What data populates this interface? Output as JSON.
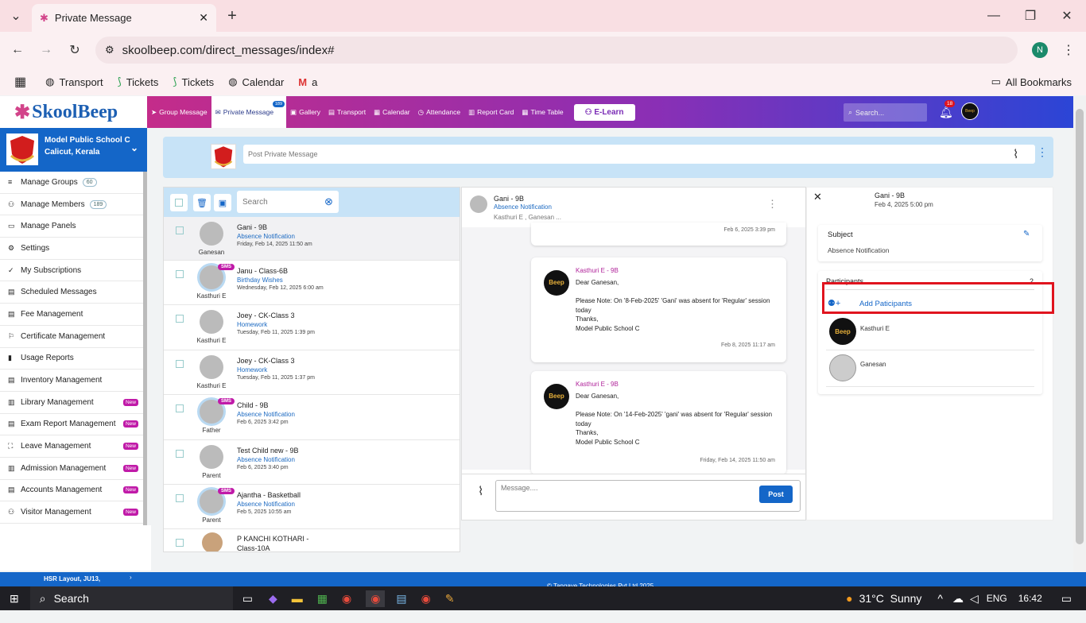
{
  "browser": {
    "tab_title": "Private Message",
    "url": "skoolbeep.com/direct_messages/index#",
    "profile_initial": "N",
    "bookmarks": [
      "Transport",
      "Tickets",
      "Tickets",
      "Calendar",
      "a"
    ],
    "all_bookmarks": "All Bookmarks"
  },
  "app": {
    "logo": "SkoolBeep",
    "nav": [
      "Group Message",
      "Private Message",
      "Gallery",
      "Transport",
      "Calendar",
      "Attendance",
      "Report Card",
      "Time Table"
    ],
    "private_badge": "189",
    "elearn": "E-Learn",
    "search_placeholder": "Search...",
    "notif_count": "18"
  },
  "school": {
    "name": "Model Public School C",
    "place": "Calicut, Kerala"
  },
  "sidebar": {
    "items": [
      {
        "label": "Manage Groups",
        "count": "60",
        "new": ""
      },
      {
        "label": "Manage Members",
        "count": "189",
        "new": ""
      },
      {
        "label": "Manage Panels",
        "count": "",
        "new": ""
      },
      {
        "label": "Settings",
        "count": "",
        "new": ""
      },
      {
        "label": "My Subscriptions",
        "count": "",
        "new": ""
      },
      {
        "label": "Scheduled Messages",
        "count": "",
        "new": ""
      },
      {
        "label": "Fee Management",
        "count": "",
        "new": ""
      },
      {
        "label": "Certificate Management",
        "count": "",
        "new": ""
      },
      {
        "label": "Usage Reports",
        "count": "",
        "new": ""
      },
      {
        "label": "Inventory Management",
        "count": "",
        "new": ""
      },
      {
        "label": "Library Management",
        "count": "",
        "new": "New"
      },
      {
        "label": "Exam Report Management",
        "count": "",
        "new": "New"
      },
      {
        "label": "Leave Management",
        "count": "",
        "new": "New"
      },
      {
        "label": "Admission Management",
        "count": "",
        "new": "New"
      },
      {
        "label": "Accounts Management",
        "count": "",
        "new": "New"
      },
      {
        "label": "Visitor Management",
        "count": "",
        "new": "New"
      }
    ]
  },
  "post": {
    "placeholder": "Post Private Message"
  },
  "list": {
    "search_placeholder": "Search",
    "rows": [
      {
        "title": "Gani - 9B",
        "sub": "Absence Notification",
        "date": "Friday, Feb 14, 2025 11:50 am",
        "avatar": "Ganesan",
        "sms": ""
      },
      {
        "title": "Janu - Class-6B",
        "sub": "Birthday Wishes",
        "date": "Wednesday, Feb 12, 2025 6:00 am",
        "avatar": "Kasthuri E",
        "sms": "SMS"
      },
      {
        "title": "Joey - CK-Class 3",
        "sub": "Homework",
        "date": "Tuesday, Feb 11, 2025 1:39 pm",
        "avatar": "Kasthuri E",
        "sms": ""
      },
      {
        "title": "Joey - CK-Class 3",
        "sub": "Homework",
        "date": "Tuesday, Feb 11, 2025 1:37 pm",
        "avatar": "Kasthuri E",
        "sms": ""
      },
      {
        "title": "Child - 9B",
        "sub": "Absence Notification",
        "date": "Feb 6, 2025 3:42 pm",
        "avatar": "Father",
        "sms": "SMS"
      },
      {
        "title": "Test Child new - 9B",
        "sub": "Absence Notification",
        "date": "Feb 6, 2025 3:40 pm",
        "avatar": "Parent",
        "sms": ""
      },
      {
        "title": "Ajantha - Basketball",
        "sub": "Absence Notification",
        "date": "Feb 5, 2025 10:55 am",
        "avatar": "Parent",
        "sms": "SMS"
      },
      {
        "title": "P KANCHI KOTHARI - Class-10A",
        "sub": "",
        "date": "",
        "avatar": "",
        "sms": ""
      }
    ]
  },
  "chat": {
    "title": "Gani - 9B",
    "subject": "Absence Notification",
    "members": "Kasthuri E , Ganesan ...",
    "prev_time": "Feb 6, 2025 3:39 pm",
    "messages": [
      {
        "sender": "Kasthuri E - 9B",
        "greeting": "Dear Ganesan,",
        "body": "Please Note: On '8-Feb-2025' 'Gani' was absent for 'Regular' session today",
        "thanks": "Thanks,",
        "sign": "Model Public School C",
        "time": "Feb 8, 2025 11:17 am"
      },
      {
        "sender": "Kasthuri E - 9B",
        "greeting": "Dear Ganesan,",
        "body": "Please Note: On '14-Feb-2025' 'gani' was absent for 'Regular' session today",
        "thanks": "Thanks,",
        "sign": "Model Public School C",
        "time": "Friday, Feb 14, 2025 11:50 am"
      }
    ],
    "input_placeholder": "Message....",
    "post_label": "Post",
    "avatar_text": "Beep"
  },
  "details": {
    "title": "Gani - 9B",
    "date": "Feb 4, 2025 5:00 pm",
    "subject_label": "Subject",
    "subject_value": "Absence Notification",
    "participants_label": "Participants",
    "participants_count": "2",
    "add_label": "Add Paticipants",
    "participants": [
      "Kasthuri E",
      "Ganesan"
    ]
  },
  "footer": {
    "address": "HSR Layout, JU13,",
    "copyright": "© Tangaye Technologies Pvt Ltd 2025"
  },
  "taskbar": {
    "search": "Search",
    "weather": "31°C  Sunny",
    "lang": "ENG",
    "time": "16:42"
  }
}
